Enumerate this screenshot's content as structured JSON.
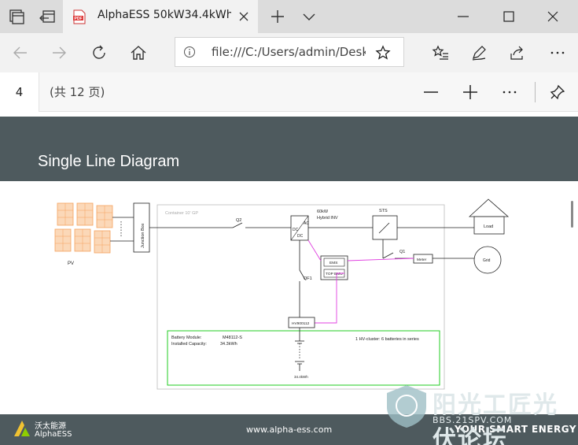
{
  "browser": {
    "tab_title": "AlphaESS 50kW34.4kWh",
    "address": "file:///C:/Users/admin/Desktop"
  },
  "pdf_toolbar": {
    "current_page": "4",
    "page_count": "(共 12 页)"
  },
  "slide": {
    "title": "Single Line Diagram",
    "footer_url": "www.alpha-ess.com",
    "footer_slogan": "YOUR SMART ENERGY",
    "logo_cn": "沃太能源",
    "logo_en": "AlphaESS"
  },
  "diagram": {
    "pv_label": "PV",
    "junction_box": "Junction Box",
    "container": "Container 10' GP",
    "q2": "Q2",
    "inverter_ac": "AC",
    "inverter_dc": "DC",
    "inverter_rating": "60kW",
    "inverter_name": "Hybrid INV",
    "sts": "STS",
    "load": "Load",
    "q1": "Q1",
    "meter": "Meter",
    "grid": "Grid",
    "ems": "EMS",
    "top_bmu": "TOP BMU",
    "qf1": "QF1",
    "hv_box": "HV900112",
    "battery_module_label": "Battery Module:",
    "battery_module_value": "M48112-S",
    "capacity_label": "Installed Capacity:",
    "capacity_value": "34.3kWh",
    "cluster_note": "1 HV-cluster: 6 batteries in series",
    "battery_total": "34.4kWh"
  },
  "watermark": {
    "text": "阳光工匠光伏论坛",
    "sub": "BBS.21SPV.COM"
  },
  "colors": {
    "slide_band": "#4e5a5e",
    "comm_line": "#e040e0",
    "battery_frame": "#22cc22",
    "pv_panel": "#f5a25d"
  }
}
